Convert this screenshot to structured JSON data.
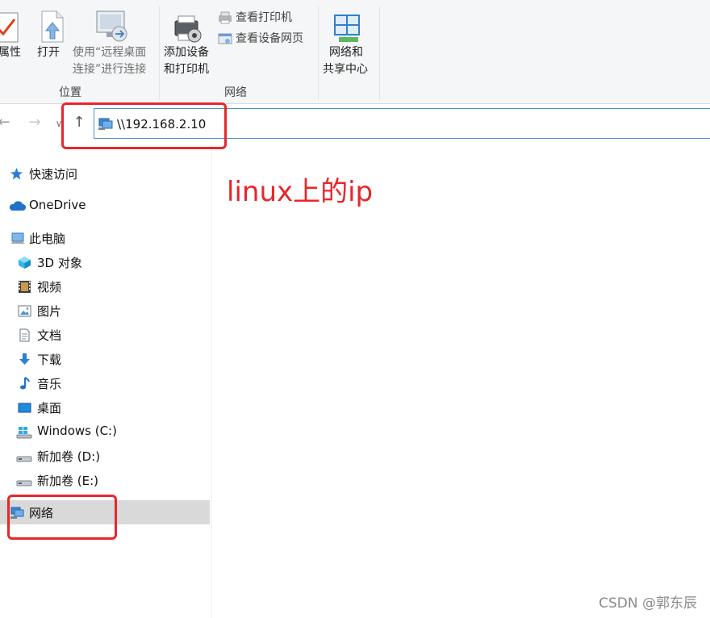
{
  "ribbon": {
    "buttons": {
      "properties": "属性",
      "open": "打开",
      "remote_line1": "使用“远程桌面",
      "remote_line2": "连接”进行连接",
      "add_device_line1": "添加设备",
      "add_device_line2": "和打印机",
      "view_printers": "查看打印机",
      "view_device_web": "查看设备网页",
      "network_center_line1": "网络和",
      "network_center_line2": "共享中心"
    },
    "groups": {
      "location": "位置",
      "network": "网络"
    }
  },
  "address_bar": {
    "path": "\\\\192.168.2.10"
  },
  "sidebar": {
    "quick_access": "快速访问",
    "onedrive": "OneDrive",
    "this_pc": "此电脑",
    "items": [
      {
        "label": "3D 对象",
        "icon": "cube-3d-icon"
      },
      {
        "label": "视频",
        "icon": "video-icon"
      },
      {
        "label": "图片",
        "icon": "pictures-icon"
      },
      {
        "label": "文档",
        "icon": "documents-icon"
      },
      {
        "label": "下载",
        "icon": "download-icon"
      },
      {
        "label": "音乐",
        "icon": "music-icon"
      },
      {
        "label": "桌面",
        "icon": "desktop-icon"
      },
      {
        "label": "Windows (C:)",
        "icon": "windows-drive-icon"
      },
      {
        "label": "新加卷 (D:)",
        "icon": "drive-icon"
      },
      {
        "label": "新加卷 (E:)",
        "icon": "drive-icon"
      }
    ],
    "network": "网络"
  },
  "annotation": {
    "text": "linux上的ip",
    "color": "#e8262a"
  },
  "watermark": "CSDN @郭东辰",
  "colors": {
    "accent": "#4a90d9",
    "selection": "#d9d9d9",
    "annotation_red": "#e8262a"
  }
}
